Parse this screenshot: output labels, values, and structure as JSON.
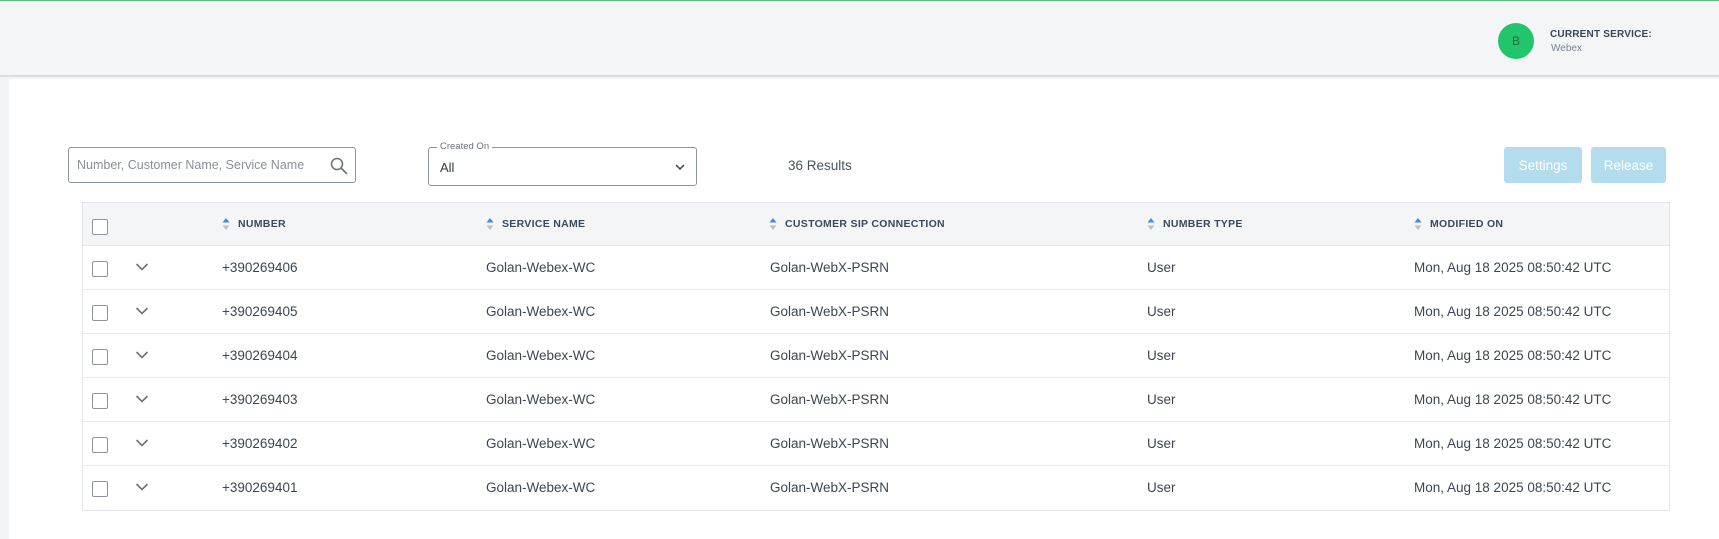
{
  "header": {
    "avatar_initial": "B",
    "current_service_label": "CURRENT SERVICE:",
    "current_service_value": "Webex"
  },
  "filters": {
    "search_placeholder": "Number, Customer Name, Service Name",
    "search_value": "",
    "created_on_label": "Created On",
    "created_on_value": "All",
    "results_text": "36 Results"
  },
  "actions": {
    "settings_label": "Settings",
    "release_label": "Release"
  },
  "table": {
    "columns": [
      "NUMBER",
      "SERVICE NAME",
      "CUSTOMER SIP CONNECTION",
      "NUMBER TYPE",
      "MODIFIED ON"
    ],
    "rows": [
      [
        "+390269406",
        "Golan-Webex-WC",
        "Golan-WebX-PSRN",
        "User",
        "Mon, Aug 18 2025 08:50:42 UTC"
      ],
      [
        "+390269405",
        "Golan-Webex-WC",
        "Golan-WebX-PSRN",
        "User",
        "Mon, Aug 18 2025 08:50:42 UTC"
      ],
      [
        "+390269404",
        "Golan-Webex-WC",
        "Golan-WebX-PSRN",
        "User",
        "Mon, Aug 18 2025 08:50:42 UTC"
      ],
      [
        "+390269403",
        "Golan-Webex-WC",
        "Golan-WebX-PSRN",
        "User",
        "Mon, Aug 18 2025 08:50:42 UTC"
      ],
      [
        "+390269402",
        "Golan-Webex-WC",
        "Golan-WebX-PSRN",
        "User",
        "Mon, Aug 18 2025 08:50:42 UTC"
      ],
      [
        "+390269401",
        "Golan-Webex-WC",
        "Golan-WebX-PSRN",
        "User",
        "Mon, Aug 18 2025 08:50:42 UTC"
      ]
    ]
  },
  "colors": {
    "avatar": "#22c46c",
    "button_disabled": "#b3dcee",
    "sort_active": "#3b8fdc",
    "top_accent": "#5cc07b"
  },
  "icons": {
    "search": "search-icon",
    "dropdown": "chevron-down-icon",
    "expand": "chevron-down-icon",
    "sort": "sort-icon"
  }
}
